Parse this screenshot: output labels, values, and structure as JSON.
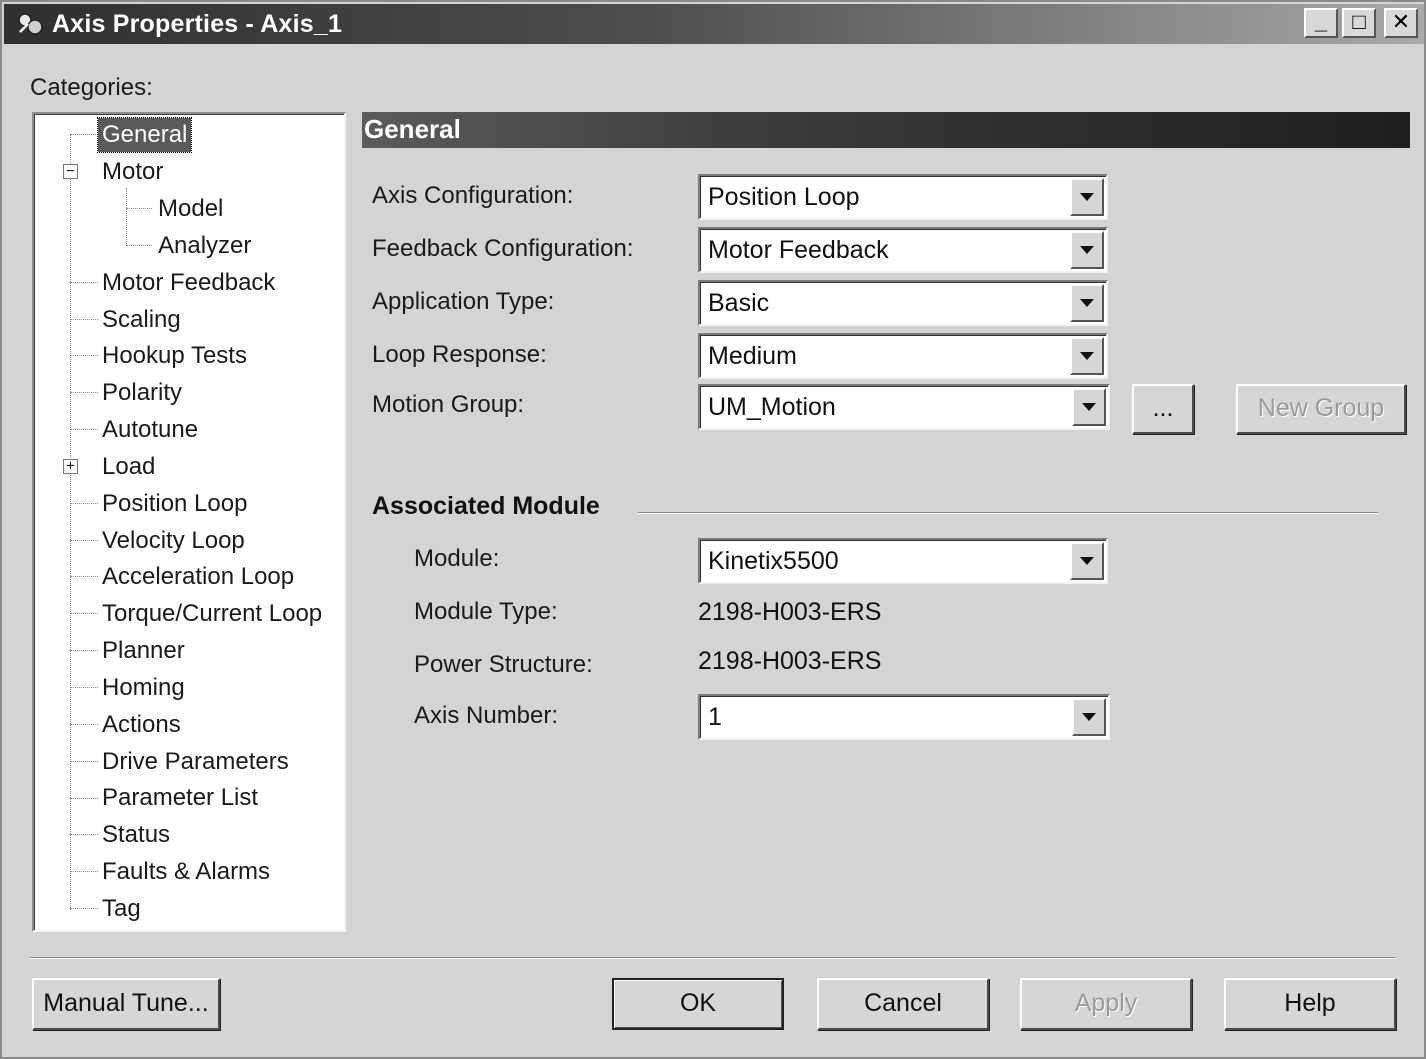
{
  "window": {
    "title": "Axis Properties - Axis_1",
    "controls": {
      "minimize": "_",
      "maximize": "□",
      "close": "✕"
    }
  },
  "categories_label": "Categories:",
  "tree": [
    {
      "label": "General",
      "selected": true
    },
    {
      "label": "Motor",
      "expander": "−"
    },
    {
      "label": "Model"
    },
    {
      "label": "Analyzer"
    },
    {
      "label": "Motor Feedback"
    },
    {
      "label": "Scaling"
    },
    {
      "label": "Hookup Tests"
    },
    {
      "label": "Polarity"
    },
    {
      "label": "Autotune"
    },
    {
      "label": "Load",
      "expander": "+"
    },
    {
      "label": "Position Loop"
    },
    {
      "label": "Velocity Loop"
    },
    {
      "label": "Acceleration Loop"
    },
    {
      "label": "Torque/Current Loop"
    },
    {
      "label": "Planner"
    },
    {
      "label": "Homing"
    },
    {
      "label": "Actions"
    },
    {
      "label": "Drive Parameters"
    },
    {
      "label": "Parameter List"
    },
    {
      "label": "Status"
    },
    {
      "label": "Faults & Alarms"
    },
    {
      "label": "Tag"
    }
  ],
  "section_title": "General",
  "fields": {
    "axis_configuration": {
      "label": "Axis Configuration:",
      "value": "Position Loop"
    },
    "feedback_configuration": {
      "label": "Feedback Configuration:",
      "value": "Motor Feedback"
    },
    "application_type": {
      "label": "Application Type:",
      "value": "Basic"
    },
    "loop_response": {
      "label": "Loop Response:",
      "value": "Medium"
    },
    "motion_group": {
      "label": "Motion Group:",
      "value": "UM_Motion"
    }
  },
  "motion_group_buttons": {
    "browse": "...",
    "new_group": "New Group"
  },
  "associated_module": {
    "title": "Associated Module",
    "module": {
      "label": "Module:",
      "value": "Kinetix5500"
    },
    "module_type": {
      "label": "Module Type:",
      "value": "2198-H003-ERS"
    },
    "power_structure": {
      "label": "Power Structure:",
      "value": "2198-H003-ERS"
    },
    "axis_number": {
      "label": "Axis Number:",
      "value": "1"
    }
  },
  "footer": {
    "manual_tune": "Manual Tune...",
    "ok": "OK",
    "cancel": "Cancel",
    "apply": "Apply",
    "help": "Help"
  }
}
